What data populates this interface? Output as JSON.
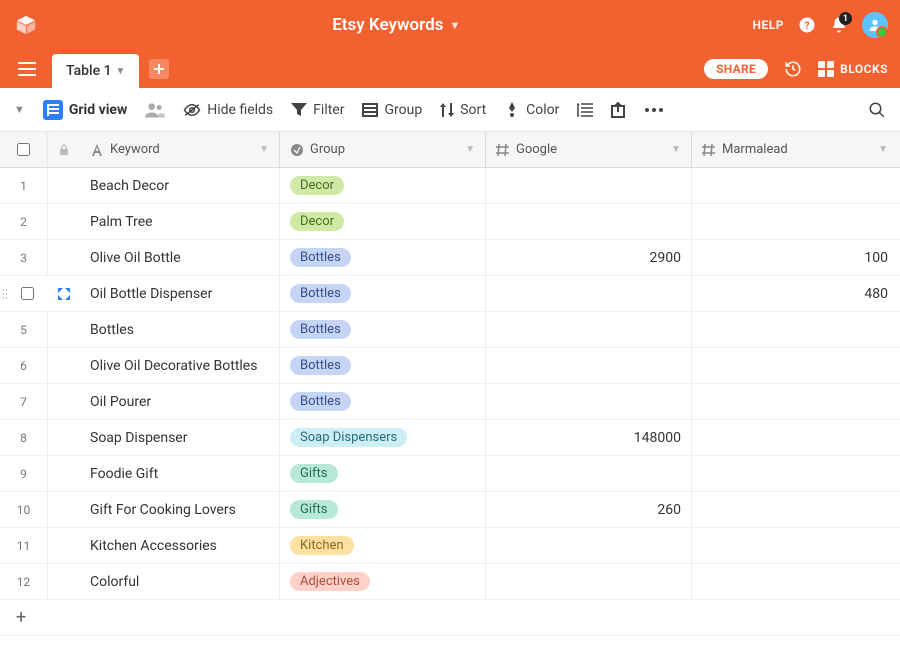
{
  "header": {
    "title": "Etsy Keywords",
    "help": "HELP",
    "notification_count": "1"
  },
  "tabs": {
    "active": "Table 1",
    "share": "SHARE",
    "blocks": "BLOCKS"
  },
  "toolbar": {
    "view_name": "Grid view",
    "hide_fields": "Hide fields",
    "filter": "Filter",
    "group": "Group",
    "sort": "Sort",
    "color": "Color"
  },
  "columns": {
    "c1": "Keyword",
    "c2": "Group",
    "c3": "Google",
    "c4": "Marmalead"
  },
  "rows": [
    {
      "n": "1",
      "keyword": "Beach Decor",
      "group": "Decor",
      "gclass": "tag-decor",
      "google": "",
      "marmalead": ""
    },
    {
      "n": "2",
      "keyword": "Palm Tree",
      "group": "Decor",
      "gclass": "tag-decor",
      "google": "",
      "marmalead": ""
    },
    {
      "n": "3",
      "keyword": "Olive Oil Bottle",
      "group": "Bottles",
      "gclass": "tag-bottles",
      "google": "2900",
      "marmalead": "100"
    },
    {
      "n": "4",
      "keyword": "Oil Bottle Dispenser",
      "group": "Bottles",
      "gclass": "tag-bottles",
      "google": "",
      "marmalead": "480",
      "hover": true
    },
    {
      "n": "5",
      "keyword": "Bottles",
      "group": "Bottles",
      "gclass": "tag-bottles",
      "google": "",
      "marmalead": ""
    },
    {
      "n": "6",
      "keyword": "Olive Oil Decorative Bottles",
      "group": "Bottles",
      "gclass": "tag-bottles",
      "google": "",
      "marmalead": ""
    },
    {
      "n": "7",
      "keyword": "Oil Pourer",
      "group": "Bottles",
      "gclass": "tag-bottles",
      "google": "",
      "marmalead": ""
    },
    {
      "n": "8",
      "keyword": "Soap Dispenser",
      "group": "Soap Dispensers",
      "gclass": "tag-soap",
      "google": "148000",
      "marmalead": ""
    },
    {
      "n": "9",
      "keyword": "Foodie Gift",
      "group": "Gifts",
      "gclass": "tag-gifts",
      "google": "",
      "marmalead": ""
    },
    {
      "n": "10",
      "keyword": "Gift For Cooking Lovers",
      "group": "Gifts",
      "gclass": "tag-gifts",
      "google": "260",
      "marmalead": ""
    },
    {
      "n": "11",
      "keyword": "Kitchen Accessories",
      "group": "Kitchen",
      "gclass": "tag-kitchen",
      "google": "",
      "marmalead": ""
    },
    {
      "n": "12",
      "keyword": "Colorful",
      "group": "Adjectives",
      "gclass": "tag-adj",
      "google": "",
      "marmalead": ""
    }
  ]
}
